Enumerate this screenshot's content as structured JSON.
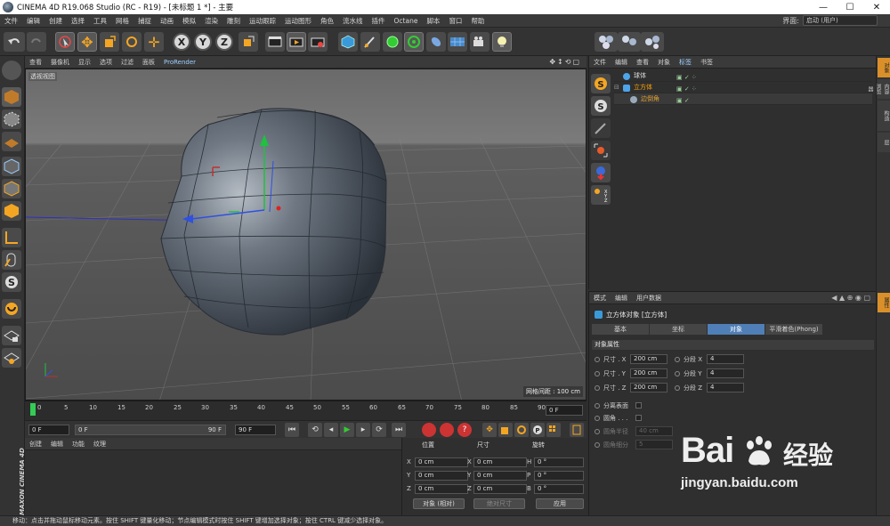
{
  "title": "CINEMA 4D R19.068 Studio (RC - R19) - [未标题 1 *] - 主要",
  "window_controls": [
    "—",
    "☐",
    "✕"
  ],
  "menu": [
    "文件",
    "编辑",
    "创建",
    "选择",
    "工具",
    "网格",
    "捕捉",
    "动画",
    "模拟",
    "渲染",
    "雕刻",
    "运动跟踪",
    "运动图形",
    "角色",
    "流水线",
    "插件",
    "Octane",
    "脚本",
    "窗口",
    "帮助"
  ],
  "layout": {
    "label": "界面:",
    "value": "启动 (用户)"
  },
  "toolbar": {
    "x": "X",
    "y": "Y",
    "z": "Z"
  },
  "viewport": {
    "menu": [
      "查看",
      "摄像机",
      "显示",
      "选项",
      "过滤",
      "面板",
      "ProRender"
    ],
    "view_label": "透视视图",
    "grid_spacing": "网格间距 : 100 cm"
  },
  "timeline": {
    "ticks": [
      "0",
      "5",
      "10",
      "15",
      "20",
      "25",
      "30",
      "35",
      "40",
      "45",
      "50",
      "55",
      "60",
      "65",
      "70",
      "75",
      "80",
      "85",
      "90"
    ],
    "end_frame": "0 F"
  },
  "transport": {
    "current": "0 F",
    "range_start": "0 F",
    "range_end": "90 F",
    "max": "90 F"
  },
  "material_panel": {
    "menu": [
      "创建",
      "编辑",
      "功能",
      "纹理"
    ]
  },
  "coords": {
    "headers": [
      "位置",
      "尺寸",
      "旋转"
    ],
    "rows": [
      {
        "axis": "X",
        "pos": "0 cm",
        "size_axis": "X",
        "size": "0 cm",
        "rot_axis": "H",
        "rot": "0 °"
      },
      {
        "axis": "Y",
        "pos": "0 cm",
        "size_axis": "Y",
        "size": "0 cm",
        "rot_axis": "P",
        "rot": "0 °"
      },
      {
        "axis": "Z",
        "pos": "0 cm",
        "size_axis": "Z",
        "size": "0 cm",
        "rot_axis": "B",
        "rot": "0 °"
      }
    ],
    "mode": "对象 (相对)",
    "size_mode": "绝对尺寸",
    "apply": "应用"
  },
  "maxon_logo": "MAXON CINEMA 4D",
  "status": "移动：点击并拖动鼠标移动元素。按住 SHIFT 键量化移动；节点编辑模式时按住 SHIFT 键增加选择对象；按住 CTRL 键减少选择对象。",
  "object_manager": {
    "menu": [
      "文件",
      "编辑",
      "查看",
      "对象",
      "标签",
      "书签"
    ],
    "objects": [
      {
        "name": "球体",
        "color": "#dcdcdc"
      },
      {
        "name": "立方体",
        "color": "#ffa400"
      },
      {
        "name": "边倒角",
        "color": "#e0a030"
      }
    ]
  },
  "attribute_manager": {
    "menu": [
      "模式",
      "编辑",
      "用户数据"
    ],
    "title": "立方体对象 [立方体]",
    "tabs": [
      "基本",
      "坐标",
      "对象",
      "平滑着色(Phong)"
    ],
    "section": "对象属性",
    "size_rows": [
      {
        "label": "尺寸 . X",
        "value": "200 cm",
        "seg_label": "分段 X",
        "seg": "4"
      },
      {
        "label": "尺寸 . Y",
        "value": "200 cm",
        "seg_label": "分段 Y",
        "seg": "4"
      },
      {
        "label": "尺寸 . Z",
        "value": "200 cm",
        "seg_label": "分段 Z",
        "seg": "4"
      }
    ],
    "separate": "分离表面",
    "fillet": "圆角 . . .",
    "fillet_radius": {
      "label": "圆角半径",
      "value": "40 cm"
    },
    "fillet_subdiv": {
      "label": "圆角细分",
      "value": "5"
    }
  },
  "right_tabs": [
    "对象",
    "内容浏览器",
    "构造",
    "层",
    "属性"
  ],
  "watermark": {
    "brand": "Bai",
    "cn": "经验",
    "url": "jingyan.baidu.com"
  }
}
